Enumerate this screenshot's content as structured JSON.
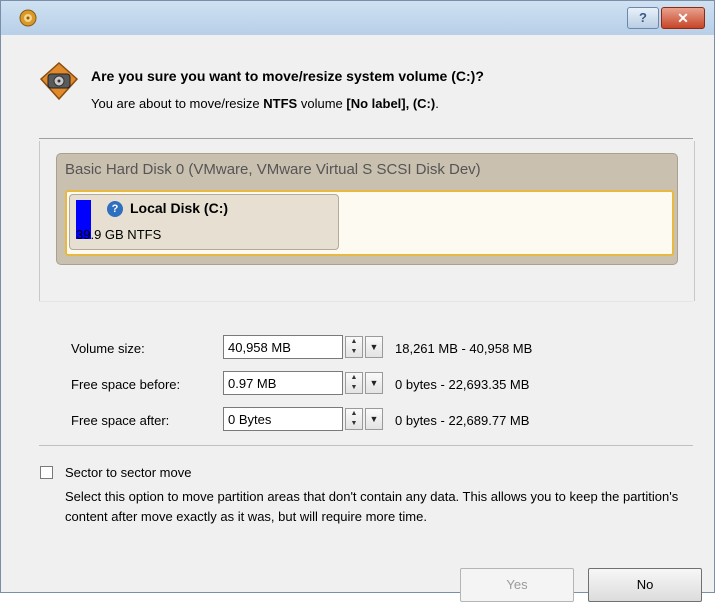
{
  "window": {
    "title": "",
    "help_label": "?",
    "close_label": "✕"
  },
  "header": {
    "question": "Are you sure you want to move/resize system volume (C:)?",
    "sub_prefix": "You are about to move/resize",
    "fs_type": "NTFS",
    "sub_mid": "volume",
    "volume_label": "[No label], (C:)",
    "sub_suffix": "."
  },
  "disk": {
    "title": "Basic Hard Disk 0 (VMware, VMware Virtual S SCSI Disk Dev)",
    "partition": {
      "name": "Local Disk (C:)",
      "size": "39.9 GB NTFS",
      "color": "#0000ff",
      "info_icon": "?"
    }
  },
  "fields": [
    {
      "label": "Volume size:",
      "value": "40,958 MB",
      "range": "18,261 MB - 40,958 MB"
    },
    {
      "label": "Free space before:",
      "value": "0.97 MB",
      "range": "0 bytes - 22,693.35 MB"
    },
    {
      "label": "Free space after:",
      "value": "0 Bytes",
      "range": "0 bytes - 22,689.77 MB"
    }
  ],
  "sector_move": {
    "checked": false,
    "label": "Sector to sector move",
    "description": "Select this option to move partition areas that don't contain any data. This allows you to keep the partition's content after move exactly as it was, but will require more time."
  },
  "buttons": {
    "yes": "Yes",
    "no": "No"
  },
  "colors": {
    "accent_border": "#e8b840",
    "close_button": "#c74527",
    "partition_bar": "#0000ff"
  }
}
